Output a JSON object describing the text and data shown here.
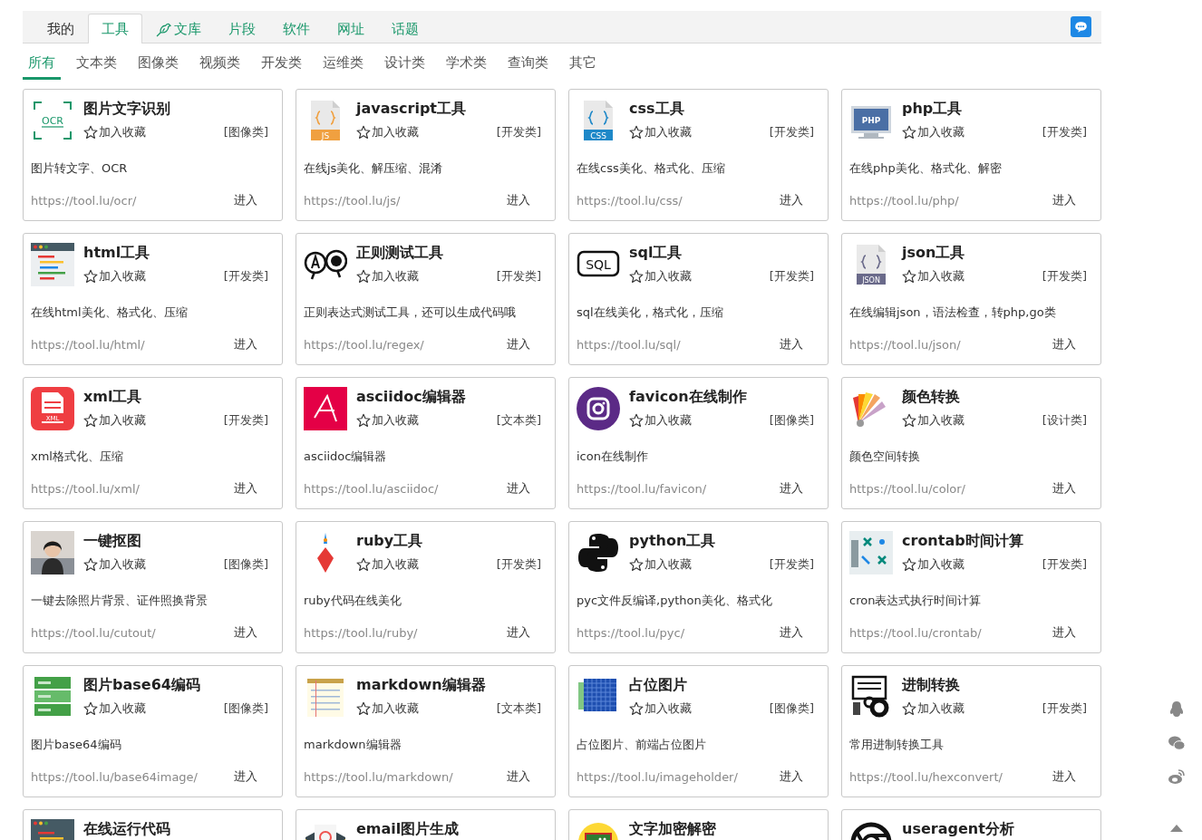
{
  "tabs": [
    {
      "label": "我的",
      "selected": false,
      "kind": "plain"
    },
    {
      "label": "工具",
      "selected": true,
      "kind": "link"
    },
    {
      "label": "文库",
      "selected": false,
      "kind": "bird"
    },
    {
      "label": "片段",
      "selected": false,
      "kind": "link"
    },
    {
      "label": "软件",
      "selected": false,
      "kind": "link"
    },
    {
      "label": "网址",
      "selected": false,
      "kind": "link"
    },
    {
      "label": "话题",
      "selected": false,
      "kind": "link"
    }
  ],
  "categories": [
    {
      "label": "所有",
      "selected": true
    },
    {
      "label": "文本类",
      "selected": false
    },
    {
      "label": "图像类",
      "selected": false
    },
    {
      "label": "视频类",
      "selected": false
    },
    {
      "label": "开发类",
      "selected": false
    },
    {
      "label": "运维类",
      "selected": false
    },
    {
      "label": "设计类",
      "selected": false
    },
    {
      "label": "学术类",
      "selected": false
    },
    {
      "label": "查询类",
      "selected": false
    },
    {
      "label": "其它",
      "selected": false
    }
  ],
  "cards": [
    {
      "title": "图片文字识别",
      "icon_text": "OCR",
      "favorite": "加入收藏",
      "category": "[图像类]",
      "description": "图片转文字、OCR",
      "url": "https://tool.lu/ocr/",
      "enter": "进入"
    },
    {
      "title": "javascript工具",
      "icon_text": "JS",
      "favorite": "加入收藏",
      "category": "[开发类]",
      "description": "在线js美化、解压缩、混淆",
      "url": "https://tool.lu/js/",
      "enter": "进入"
    },
    {
      "title": "css工具",
      "icon_text": "CSS",
      "favorite": "加入收藏",
      "category": "[开发类]",
      "description": "在线css美化、格式化、压缩",
      "url": "https://tool.lu/css/",
      "enter": "进入"
    },
    {
      "title": "php工具",
      "icon_text": "PHP",
      "favorite": "加入收藏",
      "category": "[开发类]",
      "description": "在线php美化、格式化、解密",
      "url": "https://tool.lu/php/",
      "enter": "进入"
    },
    {
      "title": "html工具",
      "favorite": "加入收藏",
      "category": "[开发类]",
      "description": "在线html美化、格式化、压缩",
      "url": "https://tool.lu/html/",
      "enter": "进入"
    },
    {
      "title": "正则测试工具",
      "favorite": "加入收藏",
      "category": "[开发类]",
      "description": "正则表达式测试工具，还可以生成代码哦",
      "url": "https://tool.lu/regex/",
      "enter": "进入"
    },
    {
      "title": "sql工具",
      "icon_text": "SQL",
      "favorite": "加入收藏",
      "category": "[开发类]",
      "description": "sql在线美化，格式化，压缩",
      "url": "https://tool.lu/sql/",
      "enter": "进入"
    },
    {
      "title": "json工具",
      "icon_text": "JSON",
      "favorite": "加入收藏",
      "category": "[开发类]",
      "description": "在线编辑json，语法检查，转php,go类",
      "url": "https://tool.lu/json/",
      "enter": "进入"
    },
    {
      "title": "xml工具",
      "icon_text": "XML",
      "favorite": "加入收藏",
      "category": "[开发类]",
      "description": "xml格式化、压缩",
      "url": "https://tool.lu/xml/",
      "enter": "进入"
    },
    {
      "title": "asciidoc编辑器",
      "favorite": "加入收藏",
      "category": "[文本类]",
      "description": "asciidoc编辑器",
      "url": "https://tool.lu/asciidoc/",
      "enter": "进入"
    },
    {
      "title": "favicon在线制作",
      "favorite": "加入收藏",
      "category": "[图像类]",
      "description": "icon在线制作",
      "url": "https://tool.lu/favicon/",
      "enter": "进入"
    },
    {
      "title": "颜色转换",
      "favorite": "加入收藏",
      "category": "[设计类]",
      "description": "颜色空间转换",
      "url": "https://tool.lu/color/",
      "enter": "进入"
    },
    {
      "title": "一键抠图",
      "favorite": "加入收藏",
      "category": "[图像类]",
      "description": "一键去除照片背景、证件照换背景",
      "url": "https://tool.lu/cutout/",
      "enter": "进入"
    },
    {
      "title": "ruby工具",
      "favorite": "加入收藏",
      "category": "[开发类]",
      "description": "ruby代码在线美化",
      "url": "https://tool.lu/ruby/",
      "enter": "进入"
    },
    {
      "title": "python工具",
      "favorite": "加入收藏",
      "category": "[开发类]",
      "description": "pyc文件反编译,python美化、格式化",
      "url": "https://tool.lu/pyc/",
      "enter": "进入"
    },
    {
      "title": "crontab时间计算",
      "favorite": "加入收藏",
      "category": "[开发类]",
      "description": "cron表达式执行时间计算",
      "url": "https://tool.lu/crontab/",
      "enter": "进入"
    },
    {
      "title": "图片base64编码",
      "favorite": "加入收藏",
      "category": "[图像类]",
      "description": "图片base64编码",
      "url": "https://tool.lu/base64image/",
      "enter": "进入"
    },
    {
      "title": "markdown编辑器",
      "favorite": "加入收藏",
      "category": "[文本类]",
      "description": "markdown编辑器",
      "url": "https://tool.lu/markdown/",
      "enter": "进入"
    },
    {
      "title": "占位图片",
      "favorite": "加入收藏",
      "category": "[图像类]",
      "description": "占位图片、前端占位图片",
      "url": "https://tool.lu/imageholder/",
      "enter": "进入"
    },
    {
      "title": "进制转换",
      "favorite": "加入收藏",
      "category": "[开发类]",
      "description": "常用进制转换工具",
      "url": "https://tool.lu/hexconvert/",
      "enter": "进入"
    },
    {
      "title": "在线运行代码"
    },
    {
      "title": "email图片生成"
    },
    {
      "title": "文字加密解密"
    },
    {
      "title": "useragent分析"
    }
  ]
}
